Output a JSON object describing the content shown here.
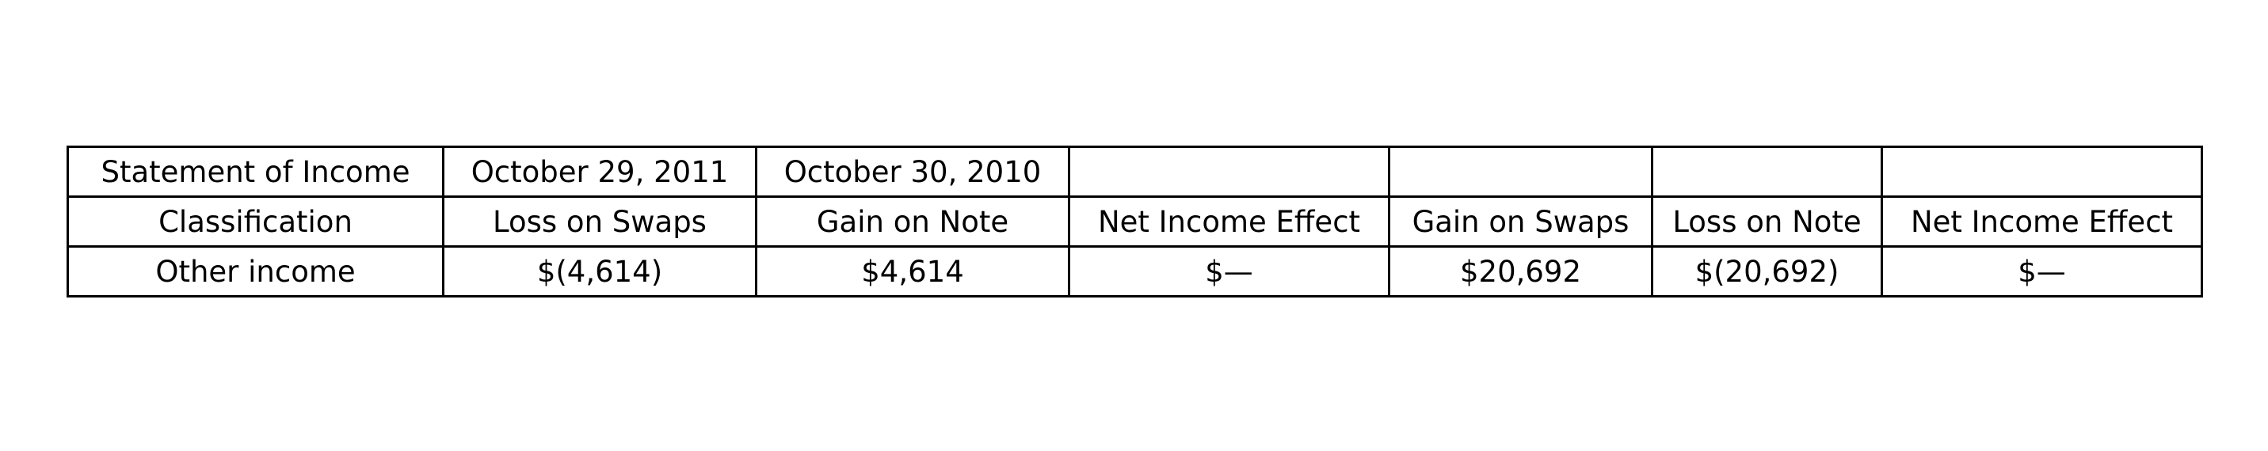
{
  "table": {
    "rows": [
      [
        "Statement of Income",
        "October 29, 2011",
        "October 30, 2010",
        "",
        "",
        "",
        ""
      ],
      [
        "Classification",
        "Loss on Swaps",
        "Gain on Note",
        "Net Income Effect",
        "Gain on Swaps",
        "Loss on Note",
        "Net Income Effect"
      ],
      [
        "Other income",
        "$(4,614)",
        "$4,614",
        "$—",
        "$20,692",
        "$(20,692)",
        "$—"
      ]
    ]
  }
}
